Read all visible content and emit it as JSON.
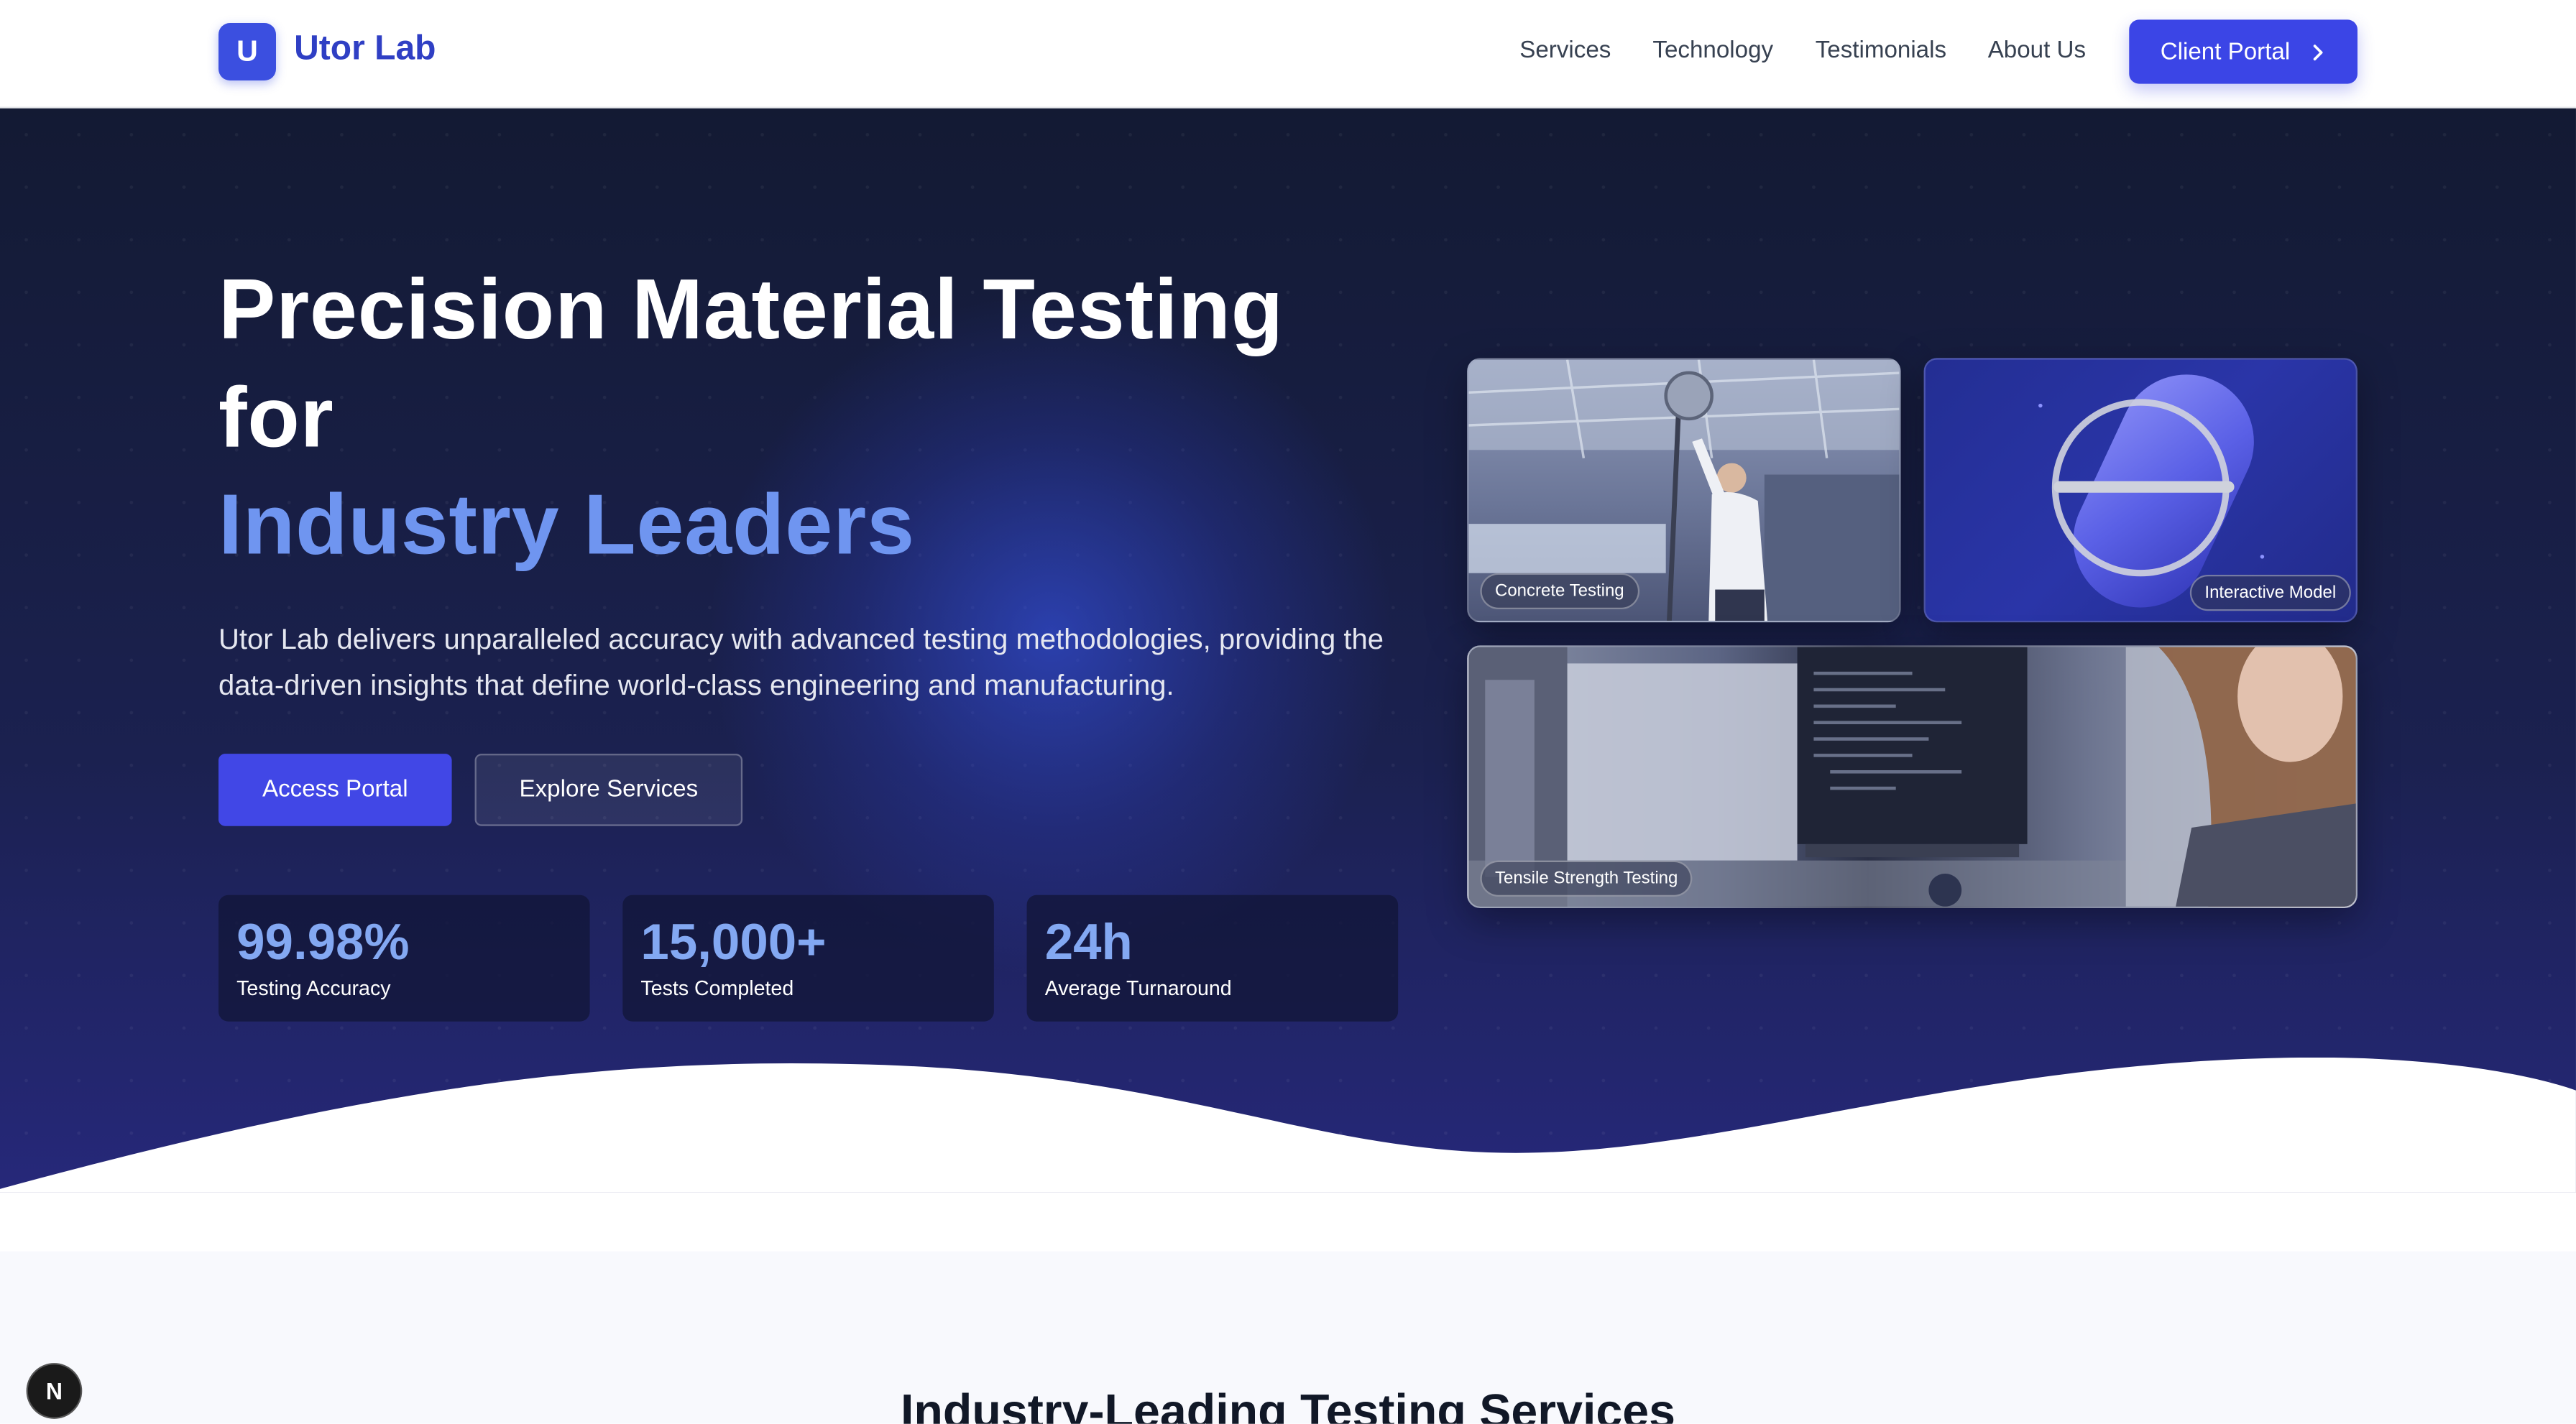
{
  "brand": {
    "logo_letter": "U",
    "name": "Utor Lab"
  },
  "nav": {
    "items": [
      "Services",
      "Technology",
      "Testimonials",
      "About Us"
    ],
    "cta_label": "Client Portal"
  },
  "hero": {
    "title_line1": "Precision Material Testing for",
    "title_line2": "Industry Leaders",
    "subtitle": "Utor Lab delivers unparalleled accuracy with advanced testing methodologies, providing the data-driven insights that define world-class engineering and manufacturing.",
    "primary_button": "Access Portal",
    "secondary_button": "Explore Services",
    "stats": [
      {
        "value": "99.98%",
        "label": "Testing Accuracy"
      },
      {
        "value": "15,000+",
        "label": "Tests Completed"
      },
      {
        "value": "24h",
        "label": "Average Turnaround"
      }
    ],
    "cards": [
      {
        "label": "Concrete Testing"
      },
      {
        "label": "Interactive Model"
      },
      {
        "label": "Tensile Strength Testing"
      }
    ]
  },
  "section": {
    "title": "Industry-Leading Testing Services"
  },
  "badge": {
    "letter": "N"
  },
  "colors": {
    "primary": "#3b45e6",
    "accent_text": "#6f95f0",
    "hero_bg": "#1b2150"
  }
}
